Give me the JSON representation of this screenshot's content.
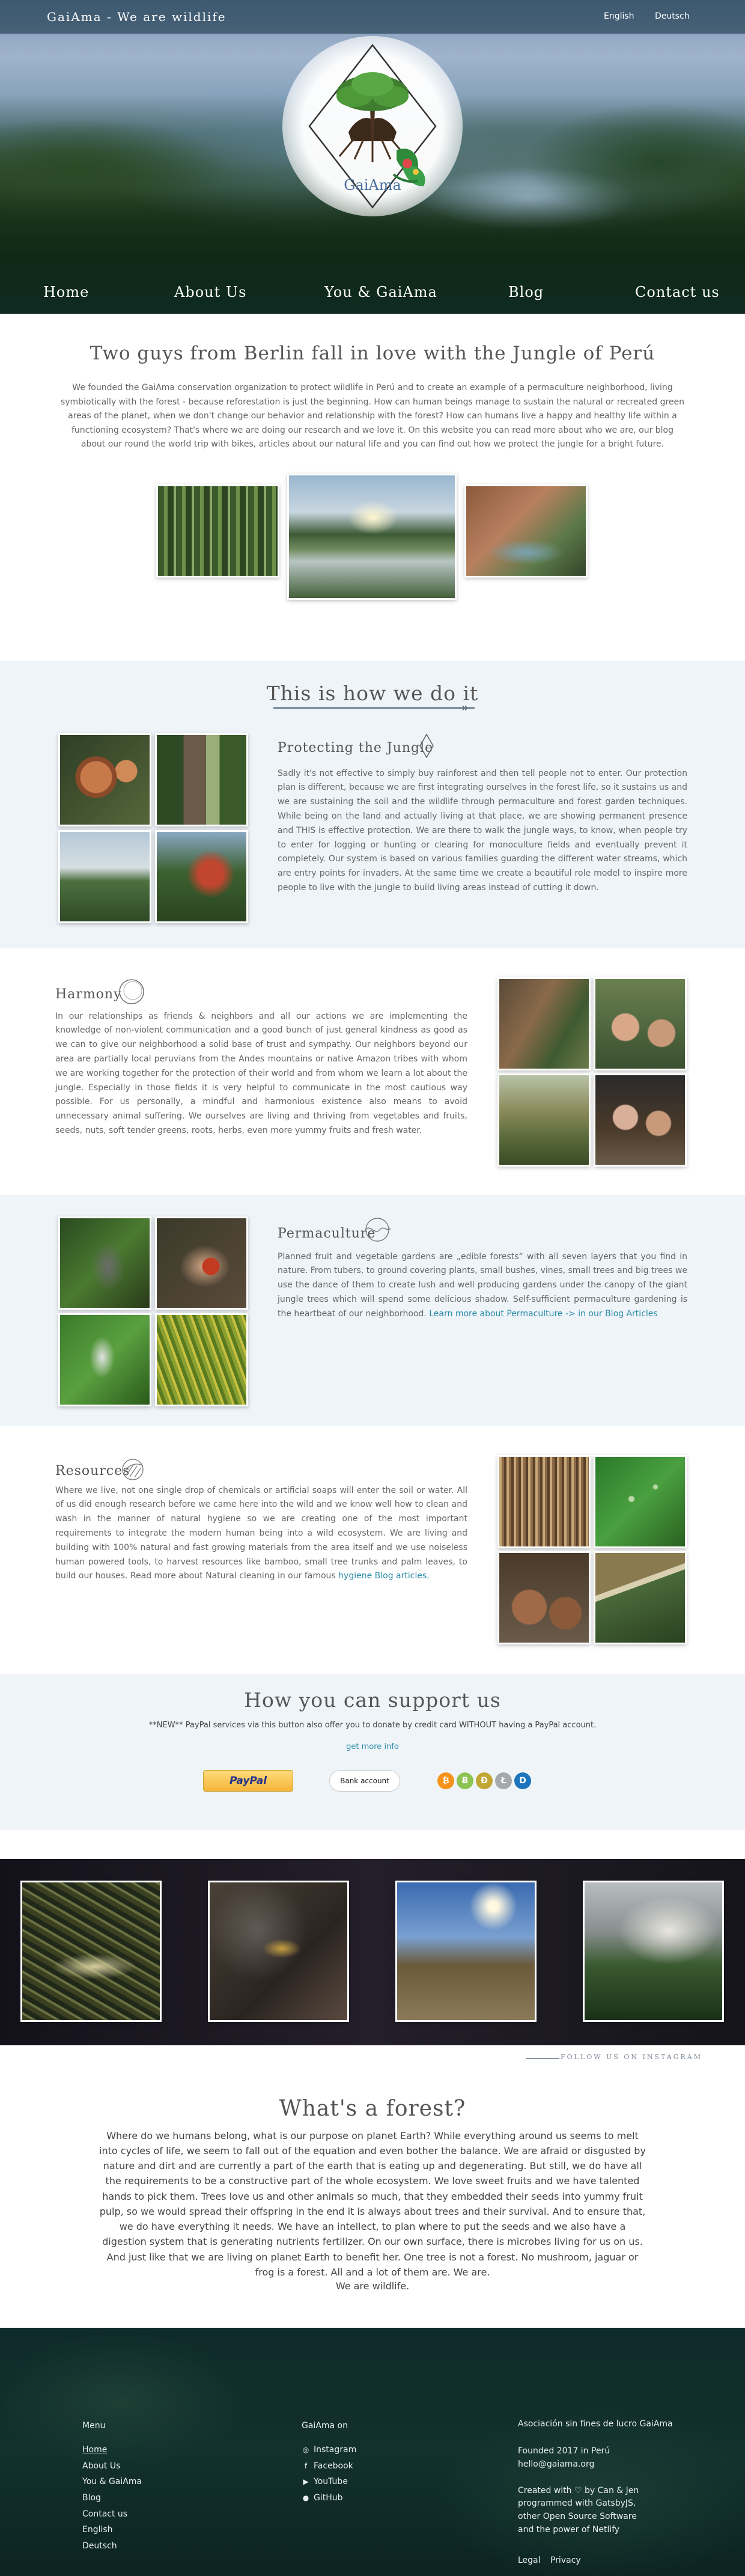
{
  "header": {
    "brand": "GaiAma - We are wildlife",
    "languages": [
      "English",
      "Deutsch"
    ],
    "logo_text": "GaiAma",
    "nav": [
      "Home",
      "About Us",
      "You & GaiAma",
      "Blog",
      "Contact us"
    ]
  },
  "intro": {
    "title": "Two guys from Berlin fall in love with the Jungle of Perú",
    "text": "We founded the GaiAma conservation organization to protect wildlife in Perú and to create an example of a permaculture neighborhood, living symbiotically with the forest - because reforestation is just the beginning. How can human beings manage to sustain the natural or recreated green areas of the planet, when we don't change our behavior and relationship with the forest? How can humans live a happy and healthy life within a functioning ecosystem? That's where we are doing our research and we love it. On this website you can read more about who we are, our blog about our round the world trip with bikes, articles about our natural life and you can find out how we protect the jungle for a bright future."
  },
  "how": {
    "title": "This is how we do it"
  },
  "protecting": {
    "heading": "Protecting the Jungle",
    "icon": "diamond-icon",
    "text": "Sadly it's not effective to simply buy rainforest and then tell people not to enter. Our protection plan is different, because we are first integrating ourselves in the forest life, so it sustains us and we are sustaining the soil and the wildlife through permaculture and forest garden techniques. While being on the land and actually living at that place, we are showing permanent presence and THIS is effective protection. We are there to walk the jungle ways, to know, when people try to enter for logging or hunting or clearing for monoculture fields and eventually prevent it completely. Our system is based on various families guarding the different water streams, which are entry points for invaders. At the same time we create a beautiful role model to inspire more people to live with the jungle to build living areas instead of cutting it down."
  },
  "harmony": {
    "heading": "Harmony",
    "icon": "circle-icon",
    "text": "In our relationships as friends & neighbors and all our actions we are implementing the knowledge of non-violent communication and a good bunch of just general kindness as good as we can to give our neighborhood a solid base of trust and sympathy. Our neighbors beyond our area are partially local peruvians from the Andes mountains or native Amazon tribes with whom we are working together for the protection of their world and from whom we learn a lot about the jungle. Especially in those fields it is very helpful to communicate in the most cautious way possible. For us personally, a mindful and harmonious existence also means to avoid unnecessary animal suffering. We ourselves are living and thriving from vegetables and fruits, seeds, nuts, soft tender greens, roots, herbs, even more yummy fruits and fresh water."
  },
  "permaculture": {
    "heading": "Permaculture",
    "icon": "wave-icon",
    "text": "Planned fruit and vegetable gardens are „edible forests“ with all seven layers that you find in nature. From tubers, to ground covering plants, small bushes, vines, small trees and big trees we use the dance of them to create lush and well producing gardens under the canopy of the giant jungle trees which will spend some delicious shadow. Self-sufficient permaculture gardening is the heartbeat of our neighborhood. ",
    "link": "Learn more about Permaculture -> in our Blog Articles"
  },
  "resources": {
    "heading": "Resources",
    "icon": "leaf-icon",
    "text": "Where we live, not one single drop of chemicals or artificial soaps will enter the soil or water. All of us did enough research before we came here into the wild and we know well how to clean and wash in the manner of natural hygiene so we are creating one of the most important requirements to integrate the modern human being into a wild ecosystem. We are living and building with 100% natural and fast growing materials from the area itself and we use noiseless human powered tools, to harvest resources like bamboo, small tree trunks and palm leaves, to build our houses. Read more about Natural cleaning in our famous ",
    "link": "hygiene Blog articles."
  },
  "support": {
    "title": "How you can support us",
    "note": "**NEW** PayPal services via this button also offer you to donate by credit card WITHOUT having a PayPal account.",
    "more_link": "get more info",
    "paypal_label": "PayPal",
    "bank_label": "Bank account",
    "coins": [
      {
        "symbol": "₿",
        "color": "#f7931a",
        "icon": "bitcoin-icon"
      },
      {
        "symbol": "Ƀ",
        "color": "#8dc351",
        "icon": "bitcoin-cash-icon"
      },
      {
        "symbol": "Ð",
        "color": "#c2a633",
        "icon": "dogecoin-icon"
      },
      {
        "symbol": "Ł",
        "color": "#a6a9aa",
        "icon": "litecoin-icon"
      },
      {
        "symbol": "D",
        "color": "#1c75bc",
        "icon": "dash-icon"
      }
    ]
  },
  "instagram": {
    "follow": "Follow us on Instagram"
  },
  "forest": {
    "title": "What's a forest?",
    "text": "Where do we humans belong, what is our purpose on planet Earth? While everything around us seems to melt into cycles of life, we seem to fall out of the equation and even bother the balance. We are afraid or disgusted by nature and dirt and are currently a part of the earth that is eating up and degenerating. But still, we do have all the requirements to be a constructive part of the whole ecosystem. We love sweet fruits and we have talented hands to pick them. Trees love us and other animals so much, that they embedded their seeds into yummy fruit pulp, so we would spread their offspring in the end it is always about trees and their survival. And to ensure that, we do have everything it needs. We have an intellect, to plan where to put the seeds and we also have a digestion system that is generating nutrients fertilizer. On our own surface, there is microbes living for us on us. And just like that we are living on planet Earth to benefit her. One tree is not a forest. No mushroom, jaguar or frog is a forest. All and a lot of them are. We are.",
    "closing": "We are wildlife."
  },
  "footer": {
    "menu_title": "Menu",
    "menu": [
      "Home",
      "About Us",
      "You & GaiAma",
      "Blog",
      "Contact us",
      "English",
      "Deutsch"
    ],
    "social_title": "GaiAma on",
    "social": [
      {
        "label": "Instagram",
        "icon": "instagram-icon",
        "glyph": "◎"
      },
      {
        "label": "Facebook",
        "icon": "facebook-icon",
        "glyph": "f"
      },
      {
        "label": "YouTube",
        "icon": "youtube-icon",
        "glyph": "▶"
      },
      {
        "label": "GitHub",
        "icon": "github-icon",
        "glyph": "●"
      }
    ],
    "assoc_title": "Asociación sin fines de lucro GaiAma",
    "founded": "Founded 2017 in Perú",
    "email": "hello@gaiama.org",
    "created": [
      "Created with ♡ by Can & Jen",
      "programmed with GatsbyJS,",
      "other Open Source Software",
      "and the power of Netlify"
    ],
    "legal": "Legal",
    "privacy": "Privacy"
  },
  "colors": {
    "accent_link": "#2b8aa8",
    "band_bg": "#eef4f8",
    "footer_bg": "#12302d",
    "paypal_yellow": "#f4b43a"
  }
}
